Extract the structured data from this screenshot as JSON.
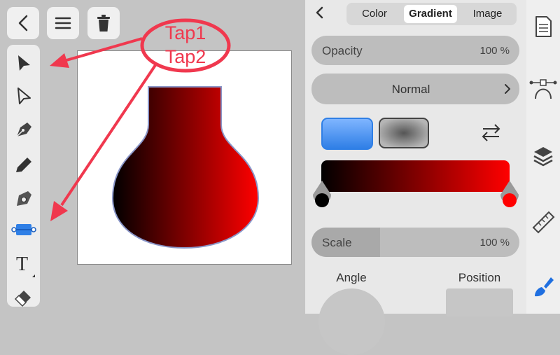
{
  "toolbar": {
    "back_icon": "chevron-left-icon",
    "menu_icon": "hamburger-menu-icon",
    "delete_icon": "trash-icon"
  },
  "tools": [
    "selection-arrow-icon",
    "direct-selection-icon",
    "pen-nib-icon",
    "pencil-icon",
    "node-tool-icon",
    "gradient-tool-icon",
    "text-tool-icon",
    "eraser-icon"
  ],
  "annotations": {
    "tap1": "Tap1",
    "tap2": "Tap2",
    "accent": "#f0384e"
  },
  "fill_panel": {
    "tabs": [
      {
        "label": "Color",
        "selected": false
      },
      {
        "label": "Gradient",
        "selected": true
      },
      {
        "label": "Image",
        "selected": false
      }
    ],
    "opacity": {
      "label": "Opacity",
      "value": "100 %"
    },
    "blend_mode": "Normal",
    "gradient": {
      "start_color": "#000000",
      "end_color": "#ff0000"
    },
    "scale": {
      "label": "Scale",
      "value": "100 %",
      "fraction": 0.33
    },
    "angle_label": "Angle",
    "position_label": "Position"
  },
  "right_sidebar": [
    "document-icon",
    "bezier-curve-icon",
    "layers-icon",
    "ruler-icon",
    "paintbrush-icon"
  ]
}
